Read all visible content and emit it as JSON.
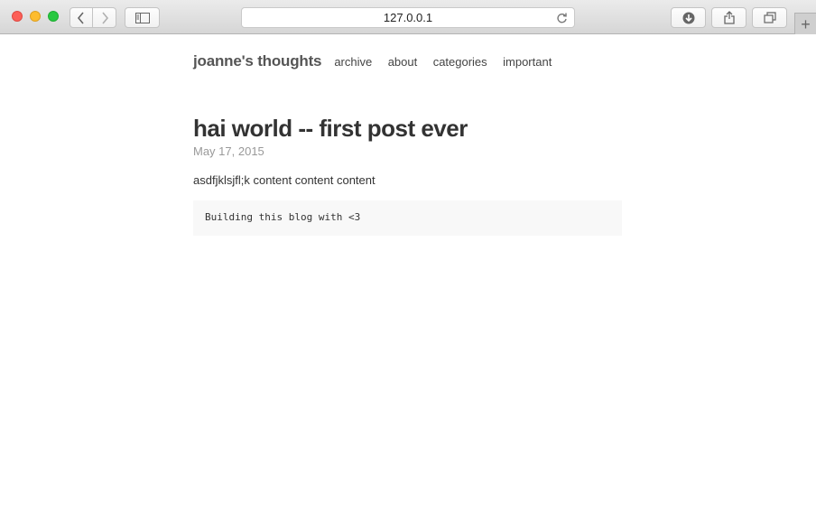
{
  "browser": {
    "url": "127.0.0.1",
    "icons": {
      "back": "chevron-left-icon",
      "forward": "chevron-right-icon",
      "sidebar": "sidebar-icon",
      "reload": "reload-icon",
      "downloads": "download-icon",
      "share": "share-icon",
      "tabs": "tabs-icon",
      "new_tab": "plus-icon"
    },
    "new_tab_glyph": "+"
  },
  "site": {
    "title": "joanne's thoughts",
    "nav": [
      "archive",
      "about",
      "categories",
      "important"
    ]
  },
  "post": {
    "title": "hai world -- first post ever",
    "date": "May 17, 2015",
    "body": "asdfjklsjfl;k content content content",
    "code": "Building this blog with <3"
  }
}
